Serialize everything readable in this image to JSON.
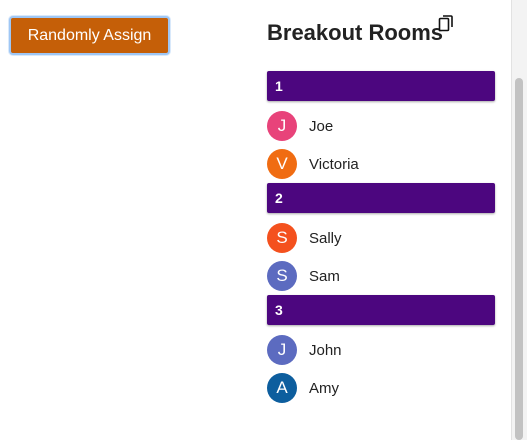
{
  "toolbar": {
    "assign_label": "Randomly Assign"
  },
  "header": {
    "title": "Breakout Rooms",
    "copy_icon": "copy-icon"
  },
  "rooms": [
    {
      "label": "1",
      "members": [
        {
          "initial": "J",
          "name": "Joe",
          "color": "#e8437a"
        },
        {
          "initial": "V",
          "name": "Victoria",
          "color": "#f06c12"
        }
      ]
    },
    {
      "label": "2",
      "members": [
        {
          "initial": "S",
          "name": "Sally",
          "color": "#f4511e"
        },
        {
          "initial": "S",
          "name": "Sam",
          "color": "#5c6bc0"
        }
      ]
    },
    {
      "label": "3",
      "members": [
        {
          "initial": "J",
          "name": "John",
          "color": "#5c6bc0"
        },
        {
          "initial": "A",
          "name": "Amy",
          "color": "#0d5e9e"
        }
      ]
    }
  ],
  "colors": {
    "assign_button": "#c55f08",
    "room_header": "#4c067f"
  }
}
